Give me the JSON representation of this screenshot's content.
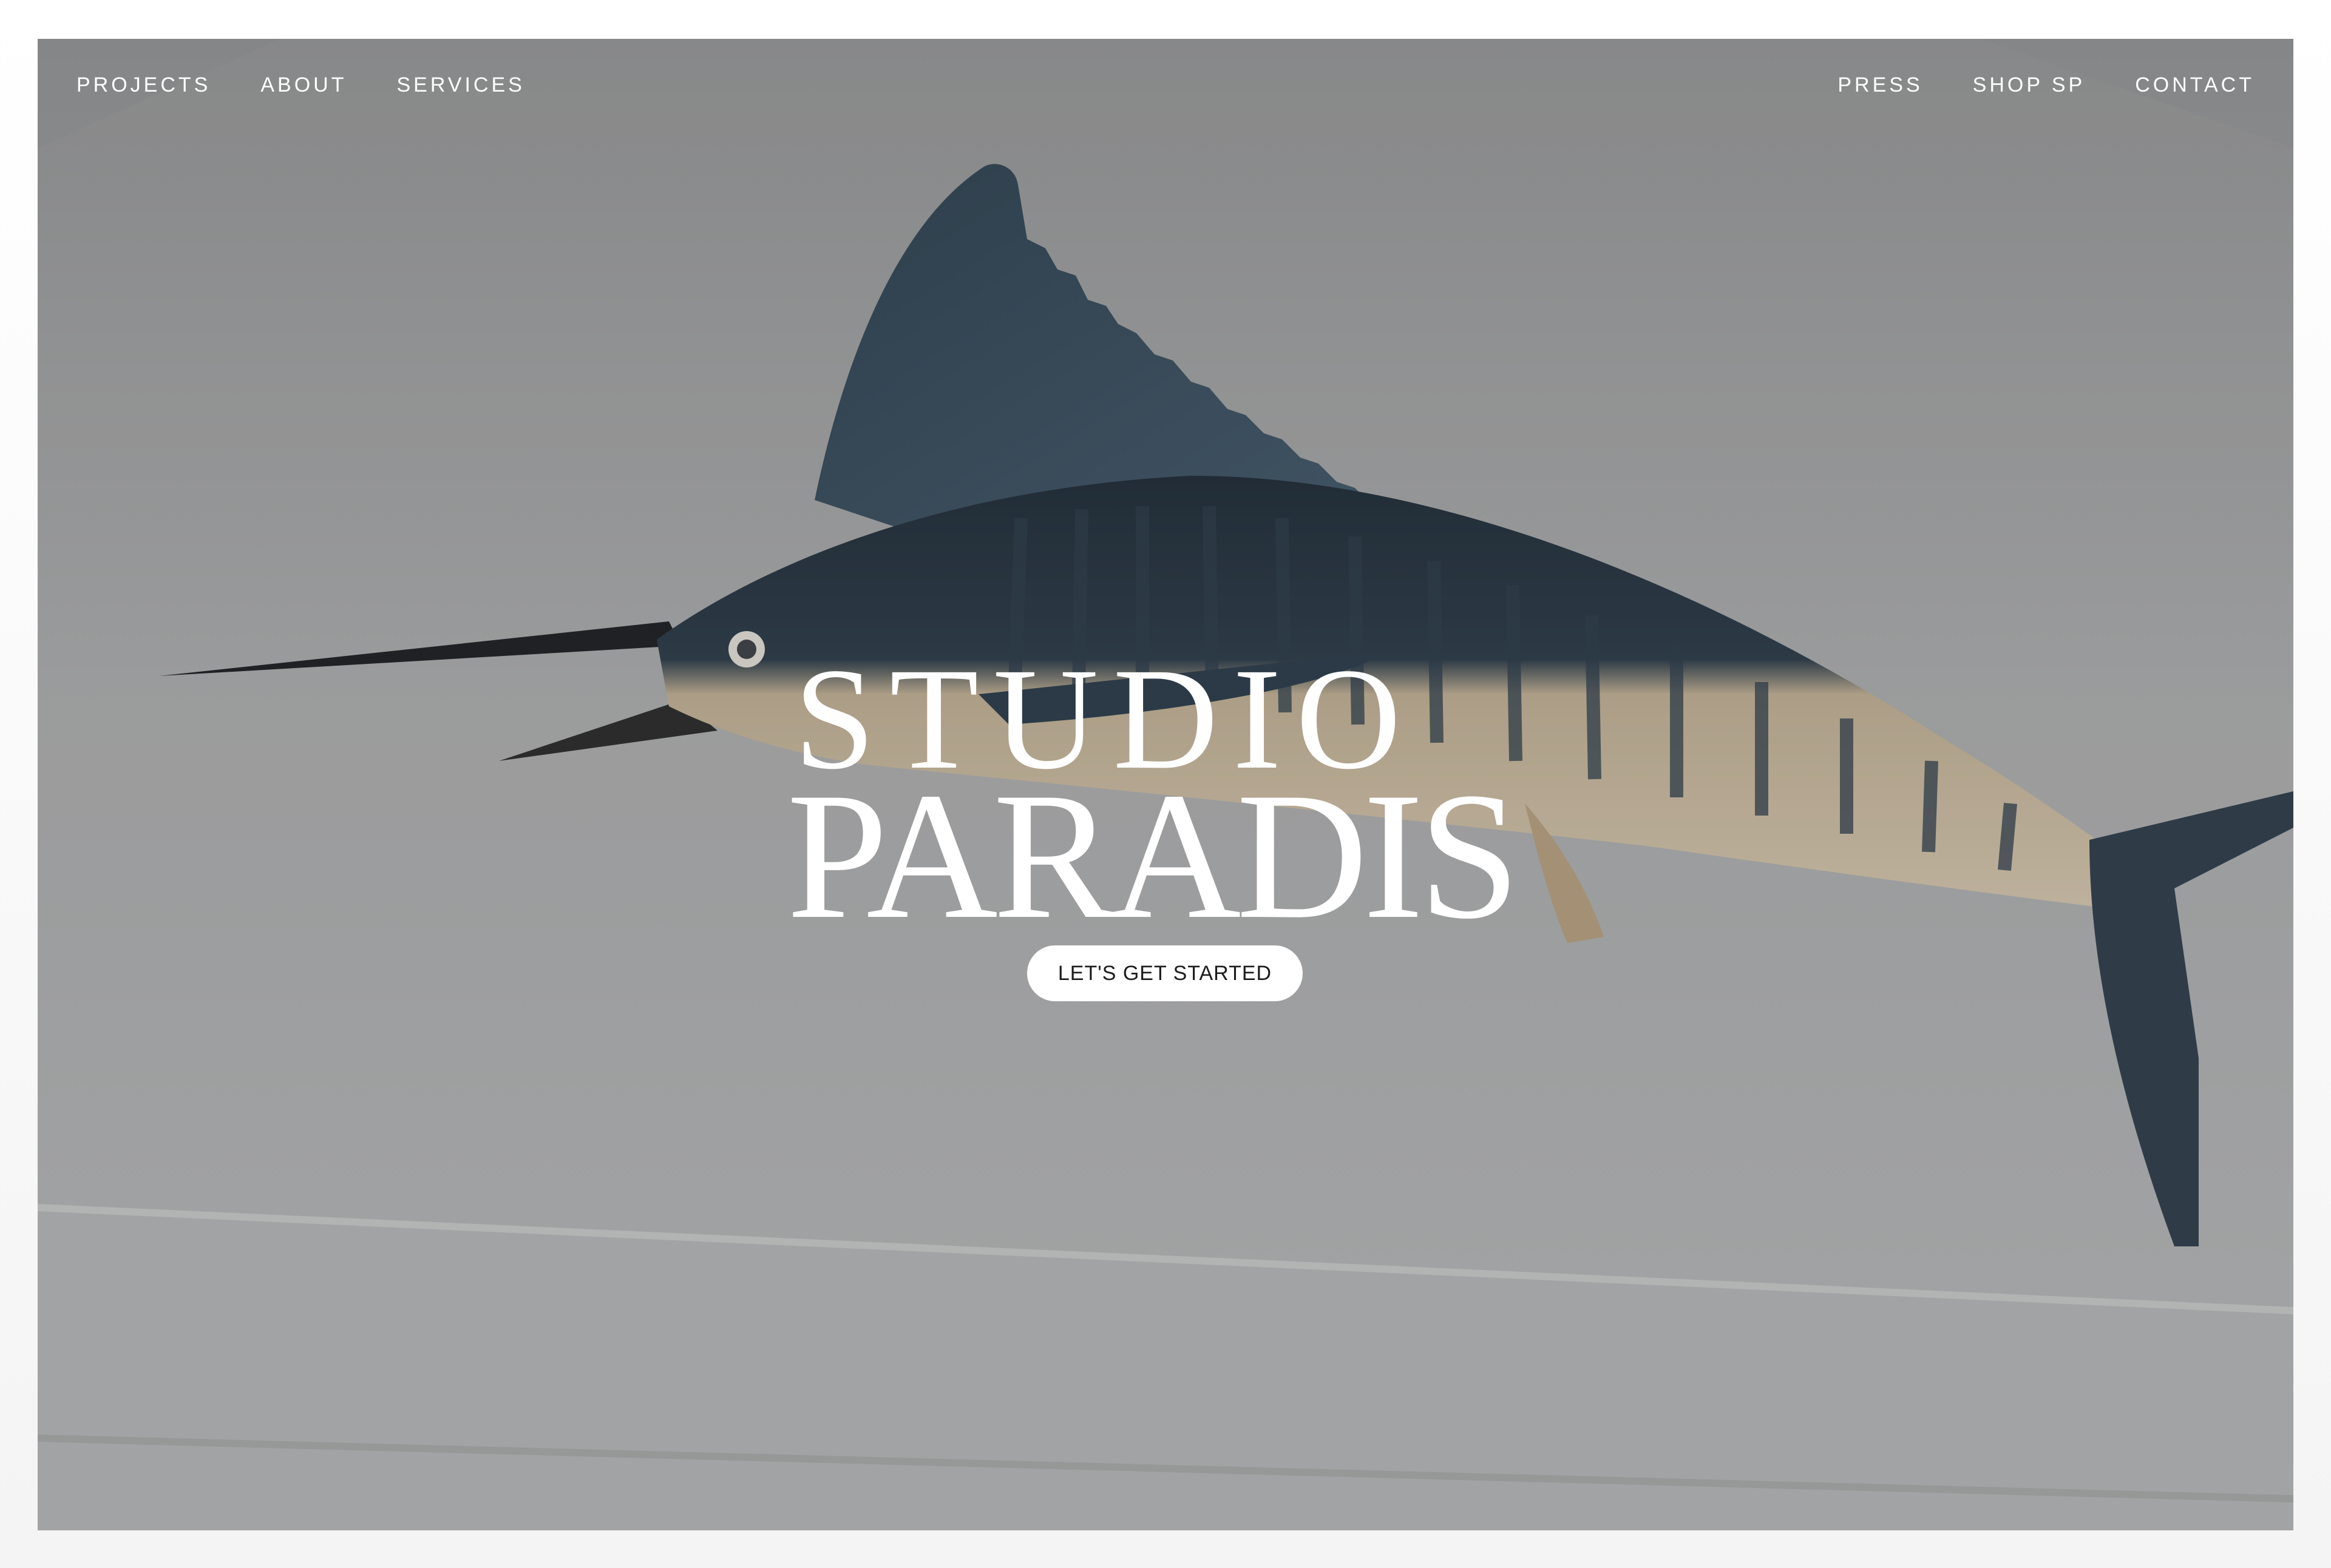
{
  "nav": {
    "left": [
      {
        "label": "PROJECTS"
      },
      {
        "label": "ABOUT"
      },
      {
        "label": "SERVICES"
      }
    ],
    "right": [
      {
        "label": "PRESS"
      },
      {
        "label": "SHOP SP"
      },
      {
        "label": "CONTACT"
      }
    ]
  },
  "hero": {
    "wordmark_line1": "STUDIO",
    "wordmark_line2": "PARADIS",
    "cta_label": "LET'S GET STARTED",
    "background_image": "marlin-mount-photo"
  },
  "colors": {
    "nav_text": "#ffffff",
    "cta_bg": "#ffffff",
    "cta_text": "#1c1c1c"
  }
}
